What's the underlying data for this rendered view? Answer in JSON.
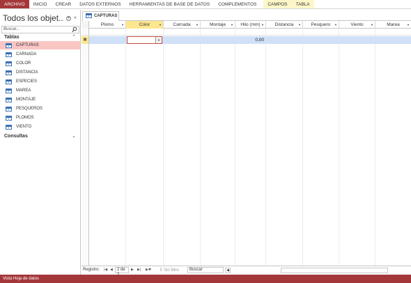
{
  "ribbon": {
    "tabs": [
      "ARCHIVO",
      "INICIO",
      "CREAR",
      "DATOS EXTERNOS",
      "HERRAMIENTAS DE BASE DE DATOS",
      "COMPLEMENTOS",
      "CAMPOS",
      "TABLA"
    ]
  },
  "nav": {
    "title": "Todos los objet...",
    "search_placeholder": "Buscar...",
    "group_tables": "Tablas",
    "group_queries": "Consultas",
    "items": [
      "CAPTURAS",
      "CARNADA",
      "COLOR",
      "DISTANCIA",
      "ESPECIES",
      "MAREA",
      "MONTAJE",
      "PESQUEROS",
      "PLOMOS",
      "VIENTO"
    ],
    "selected": "CAPTURAS"
  },
  "document": {
    "tab": "CAPTURAS"
  },
  "datasheet": {
    "columns": [
      "Plomo",
      "Color",
      "Carnada",
      "Montaje",
      "Hilo (mm)",
      "Distancia",
      "Pesquero",
      "Viento",
      "Marea"
    ],
    "new_row_marker": "✱",
    "hilo_value": "0,00"
  },
  "record_nav": {
    "label": "Registro:",
    "position": "2 de 2",
    "filter": "Sin filtro",
    "search": "Buscar"
  },
  "status": {
    "text": "Vista Hoja de datos"
  },
  "colors": {
    "accent": "#a4373a",
    "selected_nav": "#f9c6c4",
    "active_column": "#fde78e",
    "new_row": "#cfe0f7"
  }
}
